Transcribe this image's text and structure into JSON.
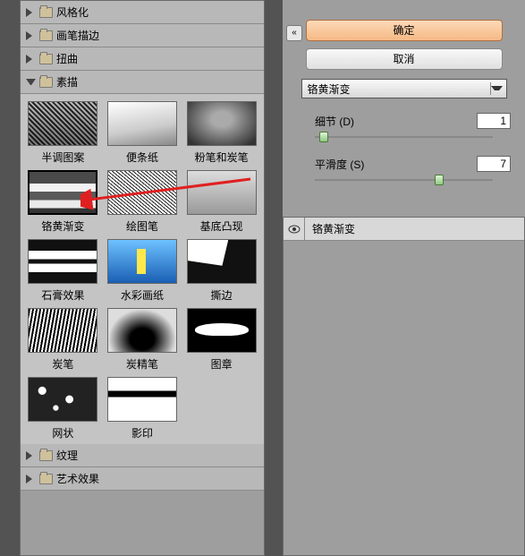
{
  "categories": {
    "stylize": "风格化",
    "brush": "画笔描边",
    "distort": "扭曲",
    "sketch": "素描",
    "texture": "纹理",
    "artistic": "艺术效果"
  },
  "sketch_items": [
    {
      "id": "halftone",
      "label": "半调图案"
    },
    {
      "id": "note",
      "label": "便条纸"
    },
    {
      "id": "chalk",
      "label": "粉笔和炭笔"
    },
    {
      "id": "chrome",
      "label": "铬黄渐变"
    },
    {
      "id": "graphic",
      "label": "绘图笔"
    },
    {
      "id": "bas",
      "label": "基底凸现"
    },
    {
      "id": "plaster",
      "label": "石膏效果"
    },
    {
      "id": "water",
      "label": "水彩画纸"
    },
    {
      "id": "torn",
      "label": "撕边"
    },
    {
      "id": "charcoal",
      "label": "炭笔"
    },
    {
      "id": "charcoal2",
      "label": "炭精笔"
    },
    {
      "id": "stamp",
      "label": "图章"
    },
    {
      "id": "retic",
      "label": "网状"
    },
    {
      "id": "photocopy",
      "label": "影印"
    }
  ],
  "selected_item_index": 3,
  "buttons": {
    "ok": "确定",
    "cancel": "取消"
  },
  "toggle": "«",
  "dropdown": {
    "selected": "铬黄渐变"
  },
  "params": {
    "detail": {
      "label": "细节 (D)",
      "value": "1",
      "pct": 5
    },
    "smooth": {
      "label": "平滑度 (S)",
      "value": "7",
      "pct": 70
    }
  },
  "layer": {
    "name": "铬黄渐变"
  },
  "thumb_art": {
    "halftone": "th-halftone",
    "note": "th-note",
    "chalk": "th-chalk",
    "chrome": "th-chrome",
    "graphic": "th-graphic",
    "bas": "th-bas",
    "plaster": "th-plaster",
    "water": "th-water",
    "torn": "th-torn",
    "charcoal": "th-charcoal",
    "charcoal2": "th-charcoal2",
    "stamp": "th-stamp",
    "retic": "th-retic",
    "photocopy": "th-photocopy"
  }
}
